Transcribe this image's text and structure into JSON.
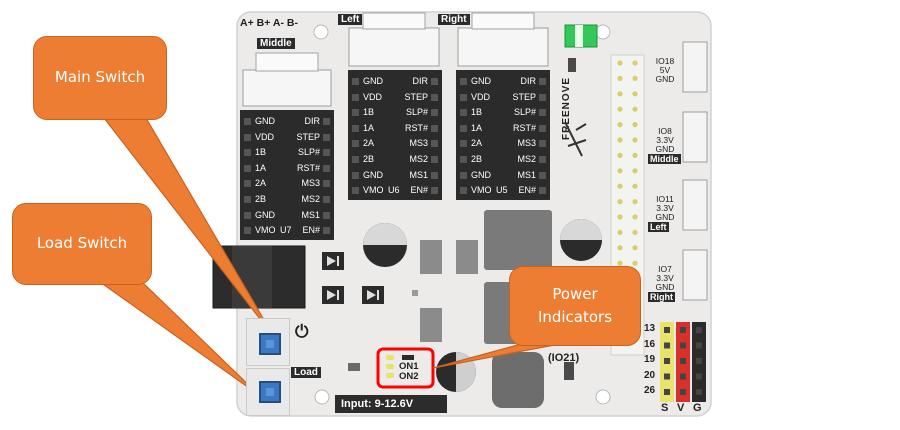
{
  "callouts": {
    "main_switch": "Main Switch",
    "load_switch": "Load Switch",
    "power_indicators_line1": "Power",
    "power_indicators_line2": "Indicators"
  },
  "board": {
    "brand": "FREENOVE",
    "input_label": "Input: 9-12.6V",
    "pins_top": "A+ B+ A- B-",
    "load_label": "Load",
    "power_symbol": "⏻",
    "io21": "(IO21)",
    "on1": "ON1",
    "on2": "ON2",
    "colors": {
      "board": "#ecebea",
      "callout": "#ee7d34",
      "highlight": "#ff0000",
      "button": "#3b78c4"
    }
  },
  "drivers": [
    {
      "id": "middle",
      "connector": "Middle",
      "left_pins": [
        "GND",
        "VDD",
        "1B",
        "1A",
        "2A",
        "2B",
        "GND",
        "VMO"
      ],
      "right_pins": [
        "DIR",
        "STEP",
        "SLP#",
        "RST#",
        "MS3",
        "MS2",
        "MS1",
        "EN#"
      ],
      "chip": "U7"
    },
    {
      "id": "left",
      "connector": "Left",
      "left_pins": [
        "GND",
        "VDD",
        "1B",
        "1A",
        "2A",
        "2B",
        "GND",
        "VMO"
      ],
      "right_pins": [
        "DIR",
        "STEP",
        "SLP#",
        "RST#",
        "MS3",
        "MS2",
        "MS1",
        "EN#"
      ],
      "chip": "U6"
    },
    {
      "id": "right",
      "connector": "Right",
      "left_pins": [
        "GND",
        "VDD",
        "1B",
        "1A",
        "2A",
        "2B",
        "GND",
        "VMO"
      ],
      "right_pins": [
        "DIR",
        "STEP",
        "SLP#",
        "RST#",
        "MS3",
        "MS2",
        "MS1",
        "EN#"
      ],
      "chip": "U5"
    }
  ],
  "side_ports": [
    {
      "io": "IO18",
      "volt": "5V",
      "gnd": "GND",
      "tag": ""
    },
    {
      "io": "IO8",
      "volt": "3.3V",
      "gnd": "GND",
      "tag": "Middle"
    },
    {
      "io": "IO11",
      "volt": "3.3V",
      "gnd": "GND",
      "tag": "Left"
    },
    {
      "io": "IO7",
      "volt": "3.3V",
      "gnd": "GND",
      "tag": "Right"
    }
  ],
  "servo_header": {
    "pins": [
      "13",
      "16",
      "19",
      "20",
      "26"
    ],
    "columns": [
      "S",
      "V",
      "G"
    ]
  }
}
